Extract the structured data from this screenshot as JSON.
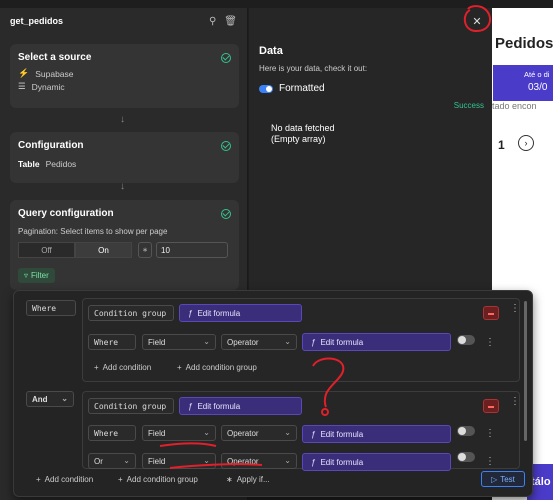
{
  "sidebar": {
    "title": "get_pedidos",
    "source": {
      "title": "Select a source",
      "items": [
        "Supabase",
        "Dynamic"
      ]
    },
    "configuration": {
      "title": "Configuration",
      "table_label": "Table",
      "table_value": "Pedidos"
    },
    "query": {
      "title": "Query configuration",
      "pagination_label": "Pagination: Select items to show per page",
      "off_label": "Off",
      "on_label": "On",
      "per_page": "10",
      "filter_label": "Filter"
    }
  },
  "data_panel": {
    "title": "Data",
    "subtitle": "Here is your data, check it out:",
    "formatted_label": "Formatted",
    "status": "Success",
    "empty_line1": "No data fetched",
    "empty_line2": "(Empty array)"
  },
  "page_bg": {
    "title": "Pedidos",
    "header_1": "Até o di",
    "header_2": "03/0",
    "muted": "tado encon",
    "page_num": "1",
    "bottom_btn": "tálo"
  },
  "filter": {
    "where_label": "Where",
    "and_label": "And",
    "group1": {
      "title": "Condition group",
      "formula": "Edit formula",
      "row": {
        "prefix": "Where",
        "field": "Field",
        "operator": "Operator",
        "formula": "Edit formula"
      },
      "add_condition": "Add condition",
      "add_group": "Add condition group"
    },
    "group2": {
      "title": "Condition group",
      "formula": "Edit formula",
      "rows": [
        {
          "prefix": "Where",
          "field": "Field",
          "operator": "Operator",
          "formula": "Edit formula"
        },
        {
          "prefix": "Or",
          "field": "Field",
          "operator": "Operator",
          "formula": "Edit formula"
        }
      ]
    },
    "footer": {
      "add_condition": "Add condition",
      "add_group": "Add condition group",
      "apply_if": "Apply if...",
      "test": "Test"
    }
  },
  "colors": {
    "accent_green": "#34c38f",
    "formula_purple": "#3a2d7a",
    "annotation_red": "#e0202a"
  }
}
